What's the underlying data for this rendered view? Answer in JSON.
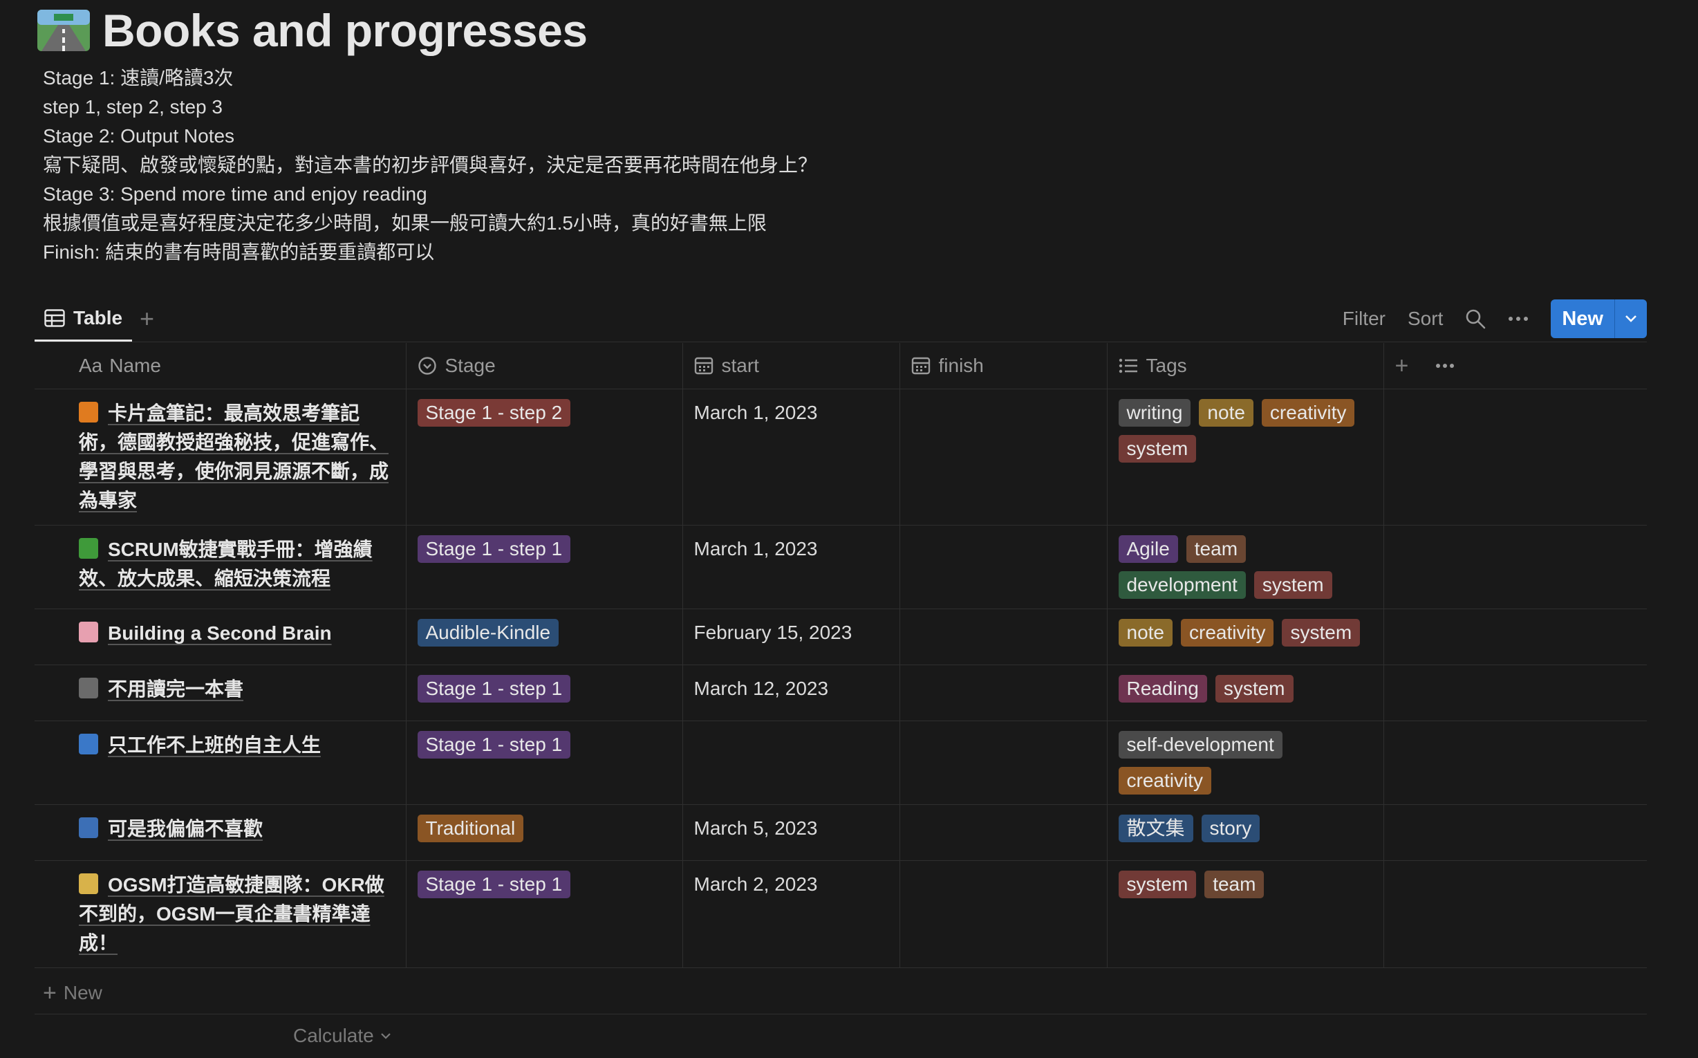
{
  "page": {
    "icon": "road-icon",
    "title": "Books and progresses",
    "description": [
      "Stage 1: 速讀/略讀3次",
      "step 1, step 2, step 3",
      "Stage 2: Output Notes",
      "寫下疑問、啟發或懷疑的點，對這本書的初步評價與喜好，決定是否要再花時間在他身上？",
      "Stage 3:  Spend more time and enjoy reading",
      "根據價值或是喜好程度決定花多少時間，如果一般可讀大約1.5小時，真的好書無上限",
      "Finish: 結束的書有時間喜歡的話要重讀都可以"
    ]
  },
  "viewbar": {
    "tab_label": "Table",
    "filter": "Filter",
    "sort": "Sort",
    "new_button": "New"
  },
  "columns": {
    "name_prefix": "Aa",
    "name": "Name",
    "stage": "Stage",
    "start": "start",
    "finish": "finish",
    "tags": "Tags"
  },
  "rows": [
    {
      "emoji": "orange-book-icon",
      "emoji_color": "#e07b1f",
      "name": "卡片盒筆記：最高效思考筆記術，德國教授超強秘技，促進寫作、學習與思考，使你洞見源源不斷，成為專家",
      "stage": "Stage 1 - step 2",
      "stage_color": "#7a3a36",
      "start": "March 1, 2023",
      "finish": "",
      "tags": [
        {
          "label": "writing",
          "color": "#4a4a4a"
        },
        {
          "label": "note",
          "color": "#8a6a2a"
        },
        {
          "label": "creativity",
          "color": "#8a5524"
        },
        {
          "label": "system",
          "color": "#713a36"
        }
      ]
    },
    {
      "emoji": "green-book-icon",
      "emoji_color": "#3f9a3a",
      "name": "SCRUM敏捷實戰手冊：增強績效、放大成果、縮短決策流程",
      "stage": "Stage 1 - step 1",
      "stage_color": "#54386f",
      "start": "March 1, 2023",
      "finish": "",
      "tags": [
        {
          "label": "Agile",
          "color": "#54386f"
        },
        {
          "label": "team",
          "color": "#6a4632"
        },
        {
          "label": "development",
          "color": "#2f5a3e"
        },
        {
          "label": "system",
          "color": "#713a36"
        }
      ]
    },
    {
      "emoji": "brain-icon",
      "emoji_color": "#e7a0b0",
      "name": "Building a Second Brain",
      "stage": "Audible-Kindle",
      "stage_color": "#2b4d75",
      "start": "February 15, 2023",
      "finish": "",
      "tags": [
        {
          "label": "note",
          "color": "#8a6a2a"
        },
        {
          "label": "creativity",
          "color": "#8a5524"
        },
        {
          "label": "system",
          "color": "#713a36"
        }
      ]
    },
    {
      "emoji": "notebook-icon",
      "emoji_color": "#6a6a6a",
      "name": "不用讀完一本書",
      "stage": "Stage 1 - step 1",
      "stage_color": "#54386f",
      "start": "March 12, 2023",
      "finish": "",
      "tags": [
        {
          "label": "Reading",
          "color": "#6e3450"
        },
        {
          "label": "system",
          "color": "#713a36"
        }
      ]
    },
    {
      "emoji": "blue-book-icon",
      "emoji_color": "#3a78c8",
      "name": "只工作不上班的自主人生",
      "stage": "Stage 1 - step 1",
      "stage_color": "#54386f",
      "start": "",
      "finish": "",
      "tags": [
        {
          "label": "self-development",
          "color": "#4a4a4a"
        },
        {
          "label": "creativity",
          "color": "#8a5524"
        }
      ]
    },
    {
      "emoji": "theater-masks-icon",
      "emoji_color": "#3c6fb6",
      "name": "可是我偏偏不喜歡",
      "stage": "Traditional",
      "stage_color": "#8a5524",
      "start": "March 5, 2023",
      "finish": "",
      "tags": [
        {
          "label": "散文集",
          "color": "#2b4d75"
        },
        {
          "label": "story",
          "color": "#2b4d75"
        }
      ]
    },
    {
      "emoji": "ledger-icon",
      "emoji_color": "#d8b24a",
      "name": "OGSM打造高敏捷團隊：OKR做不到的，OGSM一頁企畫書精準達成！",
      "stage": "Stage 1 - step 1",
      "stage_color": "#54386f",
      "start": "March 2, 2023",
      "finish": "",
      "tags": [
        {
          "label": "system",
          "color": "#713a36"
        },
        {
          "label": "team",
          "color": "#6a4632"
        }
      ]
    }
  ],
  "footer": {
    "new_row": "New",
    "calculate": "Calculate"
  }
}
